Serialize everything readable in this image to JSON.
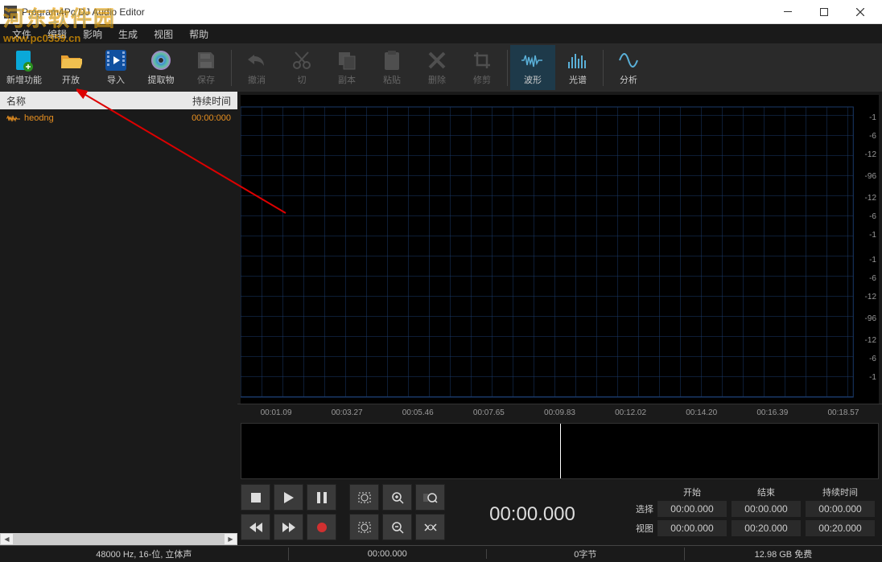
{
  "window": {
    "title": "Program4Pc DJ Audio Editor"
  },
  "menu": {
    "items": [
      "文件",
      "编辑",
      "影响",
      "生成",
      "视图",
      "帮助"
    ]
  },
  "toolbar": {
    "new": "新增功能",
    "open": "开放",
    "import": "导入",
    "extract": "提取物",
    "save": "保存",
    "undo": "撤消",
    "cut": "切",
    "copy": "副本",
    "paste": "粘贴",
    "delete": "删除",
    "trim": "修剪",
    "waveform": "波形",
    "spectrum": "光谱",
    "analyze": "分析"
  },
  "sidebar": {
    "header_name": "名称",
    "header_duration": "持续时间",
    "items": [
      {
        "name": "heodng",
        "duration": "00:00:000"
      }
    ]
  },
  "waveform_ruler": {
    "ticks": [
      "-1",
      "-6",
      "-12",
      "-96",
      "-12",
      "-6",
      "-1",
      "-1",
      "-6",
      "-12",
      "-96",
      "-12",
      "-6",
      "-1"
    ]
  },
  "timeline": {
    "ticks": [
      "00:01.09",
      "00:03.27",
      "00:05.46",
      "00:07.65",
      "00:09.83",
      "00:12.02",
      "00:14.20",
      "00:16.39",
      "00:18.57"
    ]
  },
  "transport": {
    "time": "00:00.000"
  },
  "range": {
    "headers": [
      "开始",
      "结束",
      "持续时间"
    ],
    "select_label": "选择",
    "view_label": "视图",
    "select": [
      "00:00.000",
      "00:00.000",
      "00:00.000"
    ],
    "view": [
      "00:00.000",
      "00:20.000",
      "00:20.000"
    ]
  },
  "status": {
    "format": "48000 Hz, 16-位, 立体声",
    "pos": "00:00.000",
    "size": "0字节",
    "disk": "12.98 GB 免费"
  },
  "watermark": {
    "brand": "河东软件园",
    "url": "www.pc0359.cn"
  }
}
